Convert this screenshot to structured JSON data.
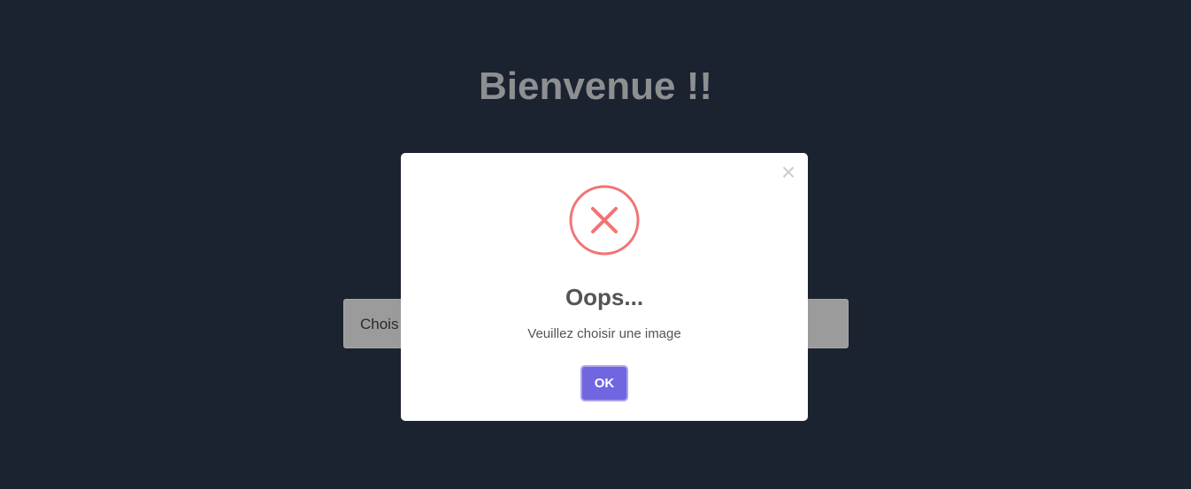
{
  "page": {
    "title": "Bienvenue !!"
  },
  "file_picker": {
    "label": "Chois"
  },
  "modal": {
    "close_glyph": "×",
    "icon": "error-x-icon",
    "title": "Oops...",
    "text": "Veuillez choisir une image",
    "ok_label": "OK"
  },
  "colors": {
    "background": "#1b2230",
    "error_icon": "#f27474",
    "ok_button": "#7066e0"
  }
}
